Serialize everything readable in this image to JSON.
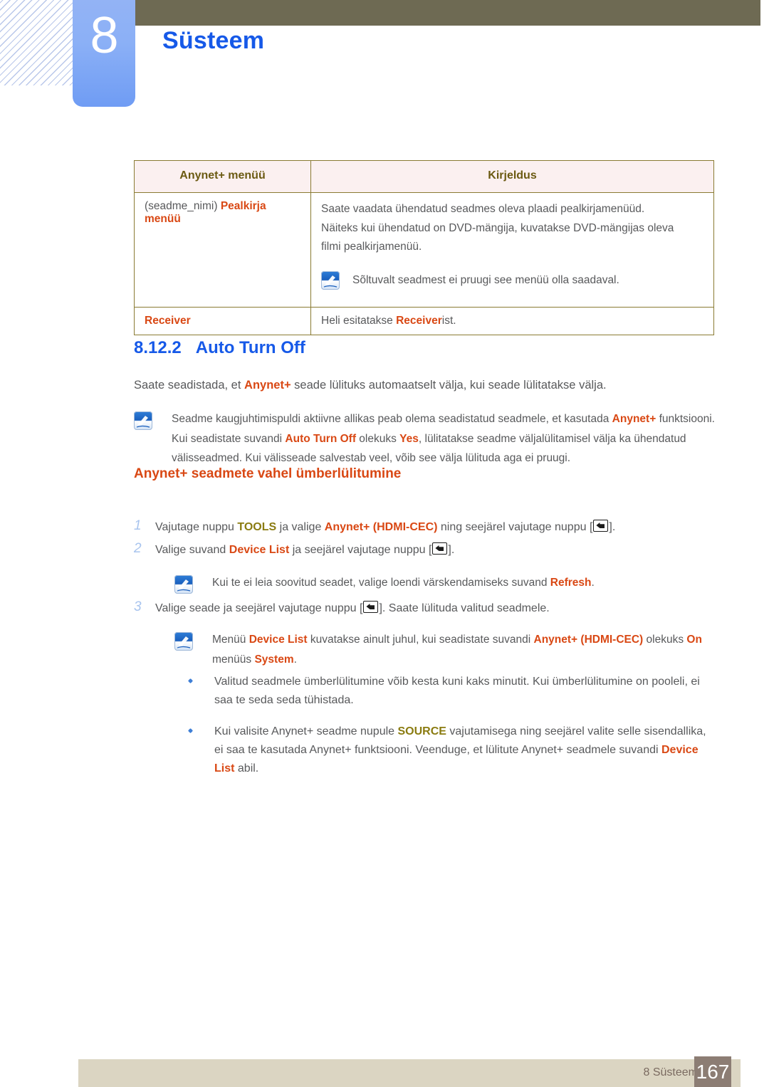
{
  "header": {
    "chapter_number": "8",
    "chapter_title": "Süsteem"
  },
  "table": {
    "columns": [
      "Anynet+ menüü",
      "Kirjeldus"
    ],
    "rows": [
      {
        "menu_prefix": "(seadme_nimi) ",
        "menu_highlight": "Pealkirja menüü",
        "desc_line1": "Saate vaadata ühendatud seadmes oleva plaadi pealkirjamenüüd.",
        "desc_line2": "Näiteks kui ühendatud on DVD-mängija, kuvatakse DVD-mängijas oleva",
        "desc_line3": "filmi pealkirjamenüü.",
        "note": "Sõltuvalt seadmest ei pruugi see menüü olla saadaval."
      },
      {
        "menu_highlight": "Receiver",
        "desc_pre": "Heli esitatakse ",
        "desc_highlight": "Receiver",
        "desc_post": "ist."
      }
    ]
  },
  "section": {
    "number": "8.12.2",
    "title": "Auto Turn Off",
    "intro_pre": "Saate seadistada, et ",
    "intro_highlight": "Anynet+",
    "intro_post": " seade lülituks automaatselt välja, kui seade lülitatakse välja."
  },
  "note_main": {
    "l1_pre": "Seadme kaugjuhtimispuldi aktiivne allikas peab olema seadistatud seadmele, et kasutada ",
    "l1_hl": "Anynet+",
    "l2_pre": "funktsiooni. Kui seadistate suvandi ",
    "l2_hl1": "Auto Turn Off",
    "l2_mid": " olekuks ",
    "l2_hl2": "Yes",
    "l2_post": ", lülitatakse seadme väljalülitamisel välja",
    "l3": "ka ühendatud välisseadmed. Kui välisseade salvestab veel, võib see välja lülituda aga ei pruugi."
  },
  "subsection": {
    "title": "Anynet+ seadmete vahel ümberlülitumine"
  },
  "steps": [
    {
      "number": "1",
      "pre": "Vajutage nuppu ",
      "hl_olive": "TOOLS",
      "mid": " ja valige ",
      "hl_orange": "Anynet+ (HDMI-CEC)",
      "post_pre": " ning seejärel vajutage nuppu [",
      "post_suffix": "]."
    },
    {
      "number": "2",
      "pre": "Valige suvand ",
      "hl_orange": "Device List",
      "post_pre": " ja seejärel vajutage nuppu [",
      "post_suffix": "]."
    },
    {
      "number": "3",
      "pre": "Valige seade ja seejärel vajutage nuppu [",
      "post_suffix": "]. Saate lülituda valitud seadmele."
    }
  ],
  "note_refresh": {
    "pre": "Kui te ei leia soovitud seadet, valige loendi värskendamiseks suvand ",
    "hl": "Refresh",
    "post": "."
  },
  "note_devicelist": {
    "l1_pre": "Menüü ",
    "l1_hl1": "Device List",
    "l1_mid": " kuvatakse ainult juhul, kui seadistate suvandi ",
    "l1_hl2": "Anynet+ (HDMI-CEC)",
    "l1_post": " olekuks",
    "l2_hl1": "On",
    "l2_mid": " menüüs ",
    "l2_hl2": "System",
    "l2_post": "."
  },
  "bullets": [
    {
      "text": "Valitud seadmele ümberlülitumine võib kesta kuni kaks minutit. Kui ümberlülitumine on pooleli, ei saa te seda seda tühistada."
    },
    {
      "pre": "Kui valisite Anynet+ seadme nupule ",
      "hl_olive": "SOURCE",
      "mid": " vajutamisega ning seejärel valite selle sisendallika, ei saa te kasutada Anynet+ funktsiooni. Veenduge, et lülitute Anynet+ seadmele suvandi ",
      "hl_orange": "Device List",
      "post": " abil."
    }
  ],
  "footer": {
    "label": "8 Süsteem",
    "page": "167"
  },
  "colors": {
    "blue_heading": "#1659e8",
    "orange_highlight": "#d94814",
    "olive_highlight": "#8a7b10",
    "body_text": "#58595b",
    "header_bar": "#6e6a53",
    "tab_blue": "#8bb0f6",
    "footer_bar": "#dbd5c2",
    "footer_page_box": "#8c7d74",
    "table_border": "#8a7b33",
    "table_header_bg": "#fbf0f0"
  }
}
